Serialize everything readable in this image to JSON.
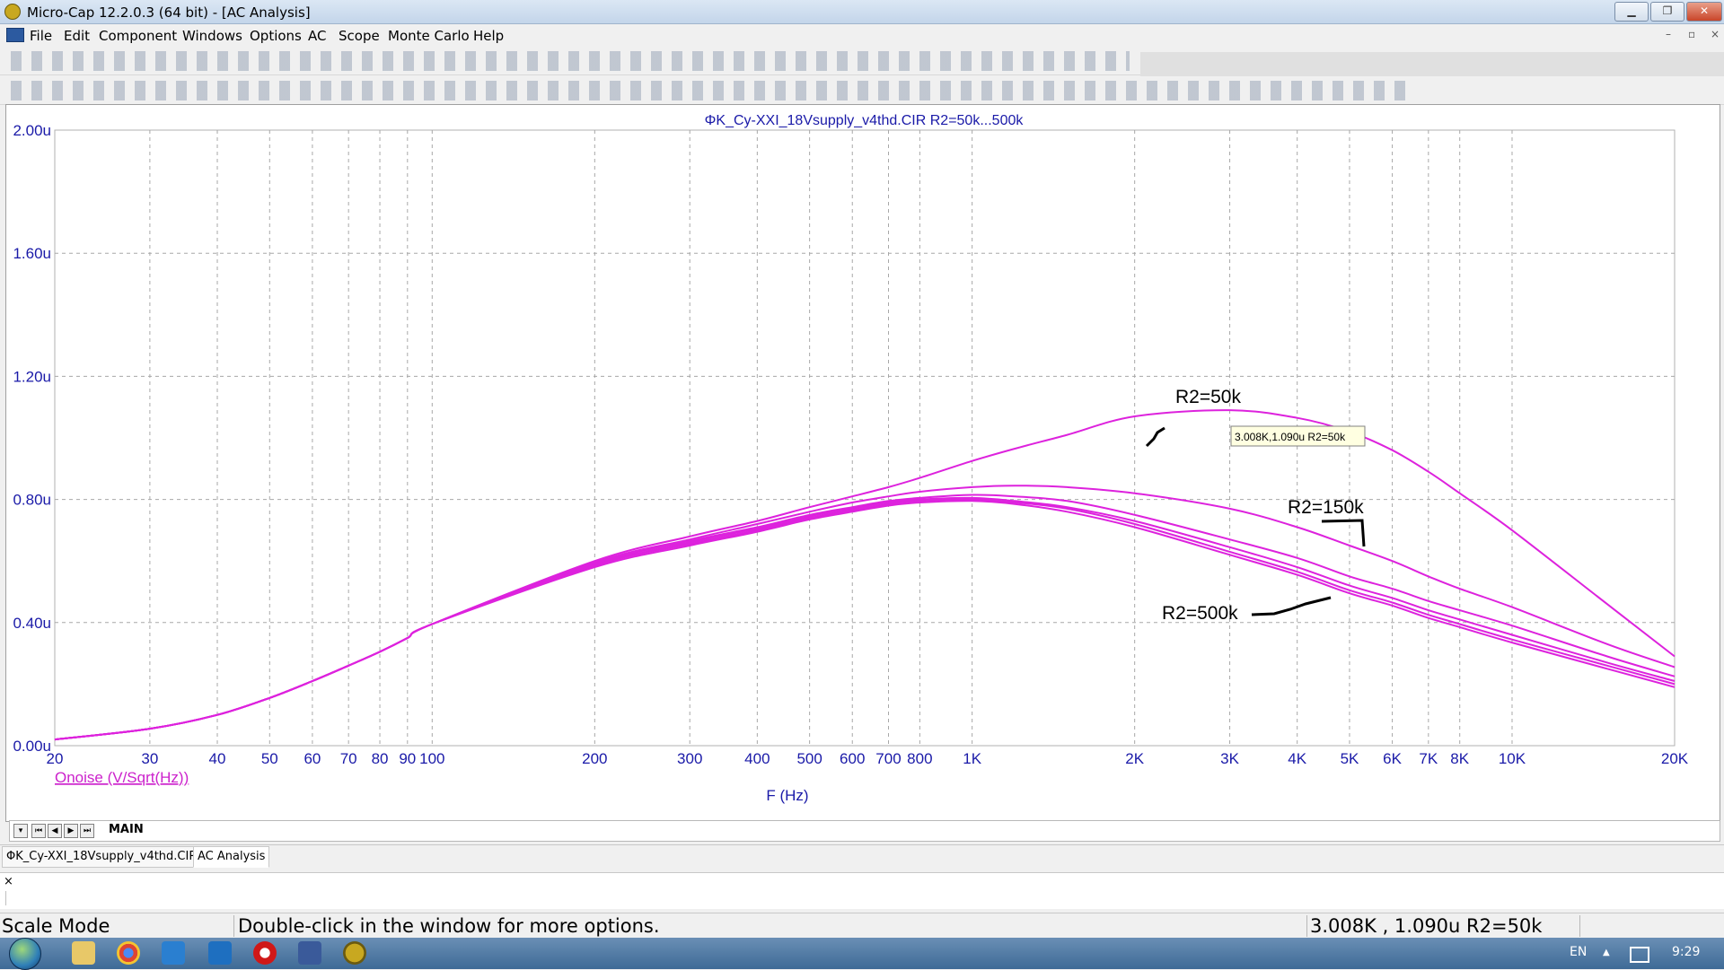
{
  "window": {
    "title": "Micro-Cap 12.2.0.3 (64 bit) - [AC Analysis]",
    "minimize": "▁",
    "restore": "❐",
    "close": "✕",
    "mdi_minimize": "–",
    "mdi_restore": "▫",
    "mdi_close": "×"
  },
  "menu": [
    "File",
    "Edit",
    "Component",
    "Windows",
    "Options",
    "AC",
    "Scope",
    "Monte Carlo",
    "Help"
  ],
  "chart_data": {
    "type": "line",
    "title": "ΦK_Cy-XXI_18Vsupply_v4thd.CIR R2=50k...500k",
    "xlabel": "F (Hz)",
    "ylabel": "Onoise (V/Sqrt(Hz))",
    "x_scale": "log",
    "xlim": [
      20,
      20000
    ],
    "ylim": [
      0,
      2.0
    ],
    "y_unit": "u",
    "grid": true,
    "x_ticks": [
      20,
      30,
      40,
      50,
      60,
      70,
      80,
      90,
      100,
      200,
      300,
      400,
      500,
      600,
      700,
      800,
      1000,
      2000,
      3000,
      4000,
      5000,
      6000,
      7000,
      8000,
      10000,
      20000
    ],
    "x_tick_labels": [
      "20",
      "30",
      "40",
      "50",
      "60",
      "70",
      "80",
      "90",
      "100",
      "200",
      "300",
      "400",
      "500",
      "600",
      "700",
      "800",
      "1K",
      "2K",
      "3K",
      "4K",
      "5K",
      "6K",
      "7K",
      "8K",
      "10K",
      "20K"
    ],
    "y_ticks": [
      0,
      0.4,
      0.8,
      1.2,
      1.6,
      2.0
    ],
    "y_tick_labels": [
      "0.00u",
      "0.40u",
      "0.80u",
      "1.20u",
      "1.60u",
      "2.00u"
    ],
    "x": [
      20,
      30,
      40,
      50,
      60,
      70,
      80,
      90,
      100,
      200,
      300,
      400,
      500,
      600,
      700,
      800,
      1000,
      1200,
      1500,
      2000,
      3000,
      4000,
      5000,
      6000,
      7000,
      8000,
      10000,
      15000,
      20000
    ],
    "series": [
      {
        "name": "R2=50k",
        "values": [
          0.02,
          0.055,
          0.1,
          0.155,
          0.21,
          0.26,
          0.305,
          0.35,
          0.395,
          0.6,
          0.68,
          0.73,
          0.775,
          0.81,
          0.84,
          0.87,
          0.925,
          0.965,
          1.01,
          1.07,
          1.09,
          1.065,
          1.02,
          0.96,
          0.89,
          0.82,
          0.7,
          0.46,
          0.29
        ]
      },
      {
        "values": [
          0.02,
          0.055,
          0.1,
          0.155,
          0.21,
          0.26,
          0.305,
          0.35,
          0.395,
          0.595,
          0.67,
          0.72,
          0.76,
          0.79,
          0.81,
          0.825,
          0.84,
          0.845,
          0.84,
          0.82,
          0.77,
          0.71,
          0.65,
          0.6,
          0.55,
          0.51,
          0.45,
          0.33,
          0.255
        ]
      },
      {
        "name": "R2=150k",
        "values": [
          0.02,
          0.055,
          0.1,
          0.155,
          0.21,
          0.26,
          0.305,
          0.35,
          0.395,
          0.59,
          0.665,
          0.71,
          0.75,
          0.775,
          0.795,
          0.805,
          0.815,
          0.81,
          0.795,
          0.75,
          0.67,
          0.61,
          0.55,
          0.51,
          0.47,
          0.44,
          0.39,
          0.29,
          0.225
        ]
      },
      {
        "values": [
          0.02,
          0.055,
          0.1,
          0.155,
          0.21,
          0.26,
          0.305,
          0.35,
          0.395,
          0.585,
          0.66,
          0.705,
          0.745,
          0.77,
          0.79,
          0.8,
          0.805,
          0.795,
          0.775,
          0.73,
          0.645,
          0.58,
          0.52,
          0.48,
          0.44,
          0.41,
          0.36,
          0.27,
          0.21
        ]
      },
      {
        "values": [
          0.02,
          0.055,
          0.1,
          0.155,
          0.21,
          0.26,
          0.305,
          0.35,
          0.395,
          0.585,
          0.655,
          0.7,
          0.74,
          0.765,
          0.785,
          0.795,
          0.8,
          0.79,
          0.77,
          0.72,
          0.63,
          0.565,
          0.505,
          0.465,
          0.425,
          0.395,
          0.345,
          0.26,
          0.2
        ]
      },
      {
        "name": "R2=500k",
        "values": [
          0.02,
          0.055,
          0.1,
          0.155,
          0.21,
          0.26,
          0.305,
          0.35,
          0.395,
          0.58,
          0.65,
          0.695,
          0.735,
          0.76,
          0.78,
          0.79,
          0.795,
          0.785,
          0.76,
          0.71,
          0.62,
          0.555,
          0.495,
          0.455,
          0.415,
          0.385,
          0.335,
          0.25,
          0.19
        ]
      }
    ],
    "annotations": [
      "R2=50k",
      "R2=150k",
      "R2=500k"
    ],
    "cursor_label": "3.008K,1.090u R2=50k",
    "color": "#dd22dd"
  },
  "sheet": {
    "tab": "MAIN"
  },
  "doc_tabs": [
    "ΦK_Cy-XXI_18Vsupply_v4thd.CIR",
    "AC Analysis"
  ],
  "output_pane": {
    "close": "×"
  },
  "status": {
    "mode": "Scale Mode",
    "hint": "Double-click in the window for more options.",
    "cursor": "3.008K , 1.090u R2=50k"
  },
  "taskbar": {
    "lang": "EN",
    "time": "9:29",
    "tray_arrow": "▲"
  }
}
